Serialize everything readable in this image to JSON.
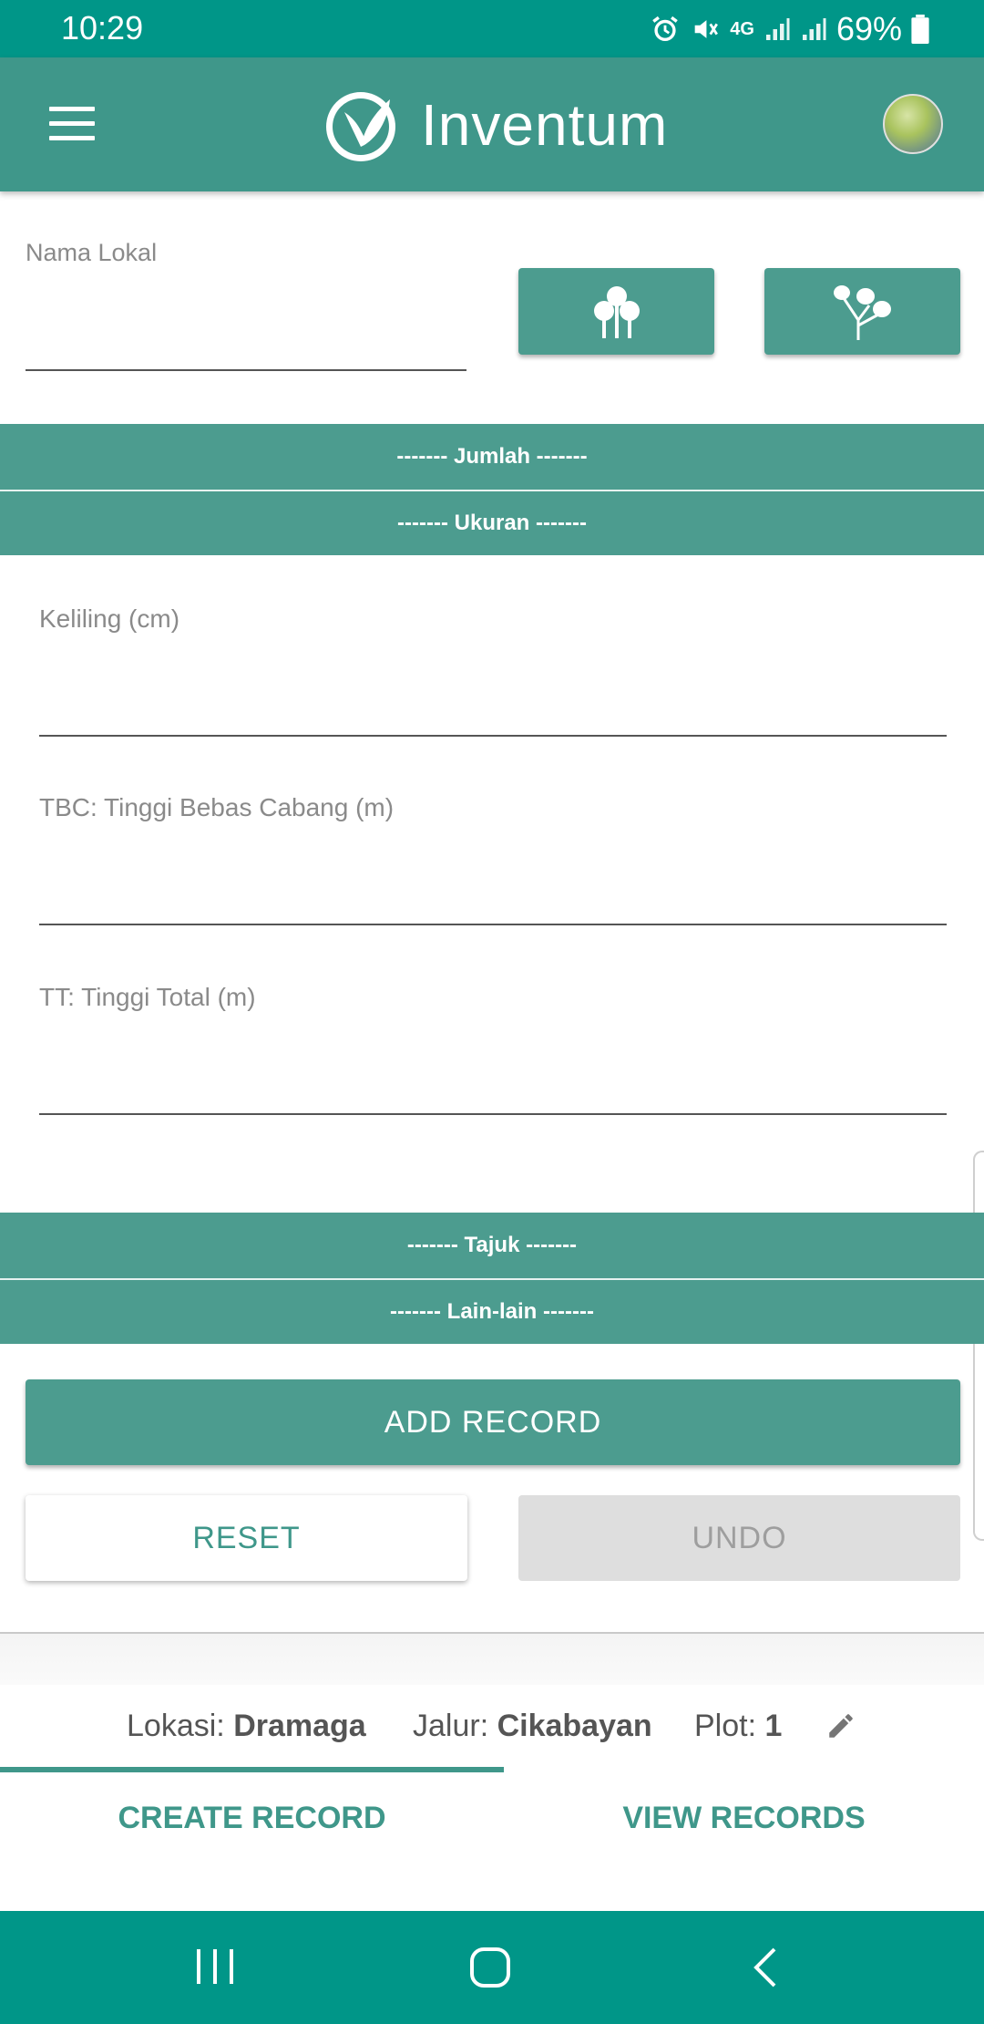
{
  "status_bar": {
    "time": "10:29",
    "network": "4G",
    "battery": "69%",
    "icons": [
      "alarm-icon",
      "mute-icon",
      "data-4g-icon",
      "signal-icon",
      "signal-icon",
      "battery-icon"
    ]
  },
  "app_bar": {
    "title": "Inventum",
    "menu_icon": "hamburger-menu-icon",
    "logo_icon": "leaf-logo-icon",
    "avatar": "user-avatar"
  },
  "form": {
    "nama_lokal": {
      "label": "Nama Lokal",
      "value": ""
    },
    "tree_buttons": [
      {
        "icon": "tree-cluster-icon"
      },
      {
        "icon": "branching-tree-icon"
      }
    ],
    "sections": {
      "jumlah": "------- Jumlah -------",
      "ukuran": "------- Ukuran -------",
      "tajuk": "------- Tajuk -------",
      "lain_lain": "------- Lain-lain -------"
    },
    "fields": [
      {
        "label": "Keliling (cm)",
        "value": ""
      },
      {
        "label": "TBC: Tinggi Bebas Cabang (m)",
        "value": ""
      },
      {
        "label": "TT: Tinggi Total (m)",
        "value": ""
      }
    ],
    "buttons": {
      "add_record": "ADD RECORD",
      "reset": "RESET",
      "undo": "UNDO"
    }
  },
  "location": {
    "lokasi_label": "Lokasi: ",
    "lokasi_value": "Dramaga",
    "jalur_label": "Jalur: ",
    "jalur_value": "Cikabayan",
    "plot_label": "Plot: ",
    "plot_value": "1",
    "edit_icon": "pencil-edit-icon"
  },
  "tabs": [
    {
      "label": "CREATE RECORD",
      "active": true
    },
    {
      "label": "VIEW RECORDS",
      "active": false
    }
  ],
  "nav_bar": {
    "icons": [
      "recents-icon",
      "home-icon",
      "back-icon"
    ]
  },
  "colors": {
    "status_bar": "#009688",
    "primary": "#3f978a",
    "section": "#4c9c8f",
    "disabled": "#dedede"
  }
}
